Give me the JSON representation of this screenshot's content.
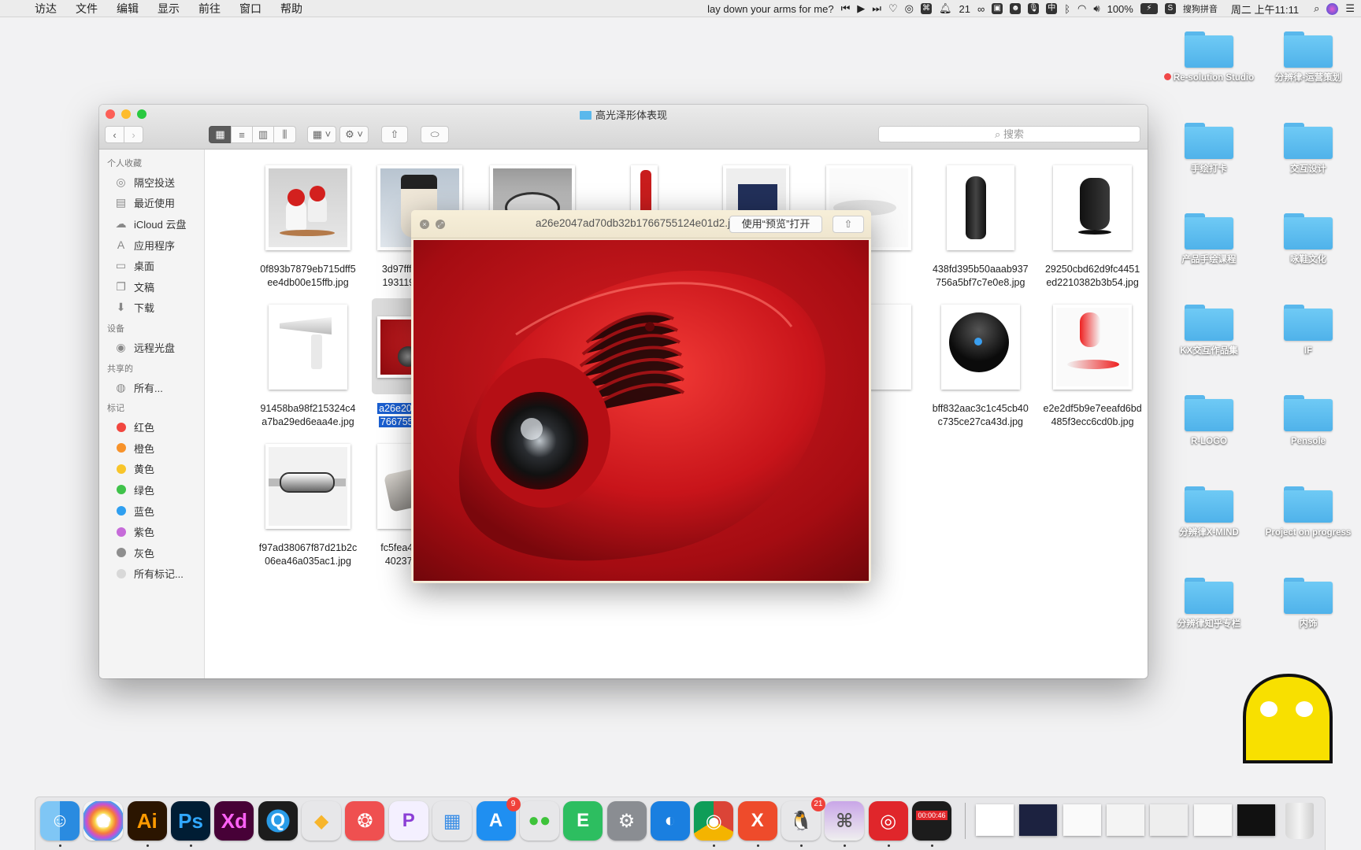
{
  "menubar": {
    "apple_icon": "apple-icon",
    "items": [
      "访达",
      "文件",
      "编辑",
      "显示",
      "前往",
      "窗口",
      "帮助"
    ],
    "now_playing": "lay down your arms for me?",
    "notification_count": "21",
    "battery": "100%",
    "input_method": "搜狗拼音",
    "clock": "周二 上午11:11"
  },
  "desktop": {
    "folders": [
      {
        "name": "Re-solution Studio",
        "tag": "#f04848"
      },
      {
        "name": "分辨律-运营策划"
      },
      {
        "name": "手绘打卡"
      },
      {
        "name": "交互设计"
      },
      {
        "name": "产品手绘课程"
      },
      {
        "name": "咏鞋文化"
      },
      {
        "name": "KX交互作品集"
      },
      {
        "name": "IF"
      },
      {
        "name": "R-LOGO"
      },
      {
        "name": "Pensole"
      },
      {
        "name": "分辨律X-MIND"
      },
      {
        "name": "Project on progress"
      },
      {
        "name": "分辨律知乎专栏"
      },
      {
        "name": "内饰"
      }
    ]
  },
  "finder": {
    "title": "高光泽形体表现",
    "search_placeholder": "搜索",
    "view_mode": "icon",
    "sidebar": [
      {
        "heading": "个人收藏",
        "items": [
          {
            "label": "隔空投送",
            "icon": "airdrop-icon",
            "glyph": "◎"
          },
          {
            "label": "最近使用",
            "icon": "recents-icon",
            "glyph": "▤"
          },
          {
            "label": "iCloud 云盘",
            "icon": "cloud-icon",
            "glyph": "☁"
          },
          {
            "label": "应用程序",
            "icon": "applications-icon",
            "glyph": "A"
          },
          {
            "label": "桌面",
            "icon": "desktop-icon",
            "glyph": "▭"
          },
          {
            "label": "文稿",
            "icon": "documents-icon",
            "glyph": "❐"
          },
          {
            "label": "下载",
            "icon": "downloads-icon",
            "glyph": "⬇"
          }
        ]
      },
      {
        "heading": "设备",
        "items": [
          {
            "label": "远程光盘",
            "icon": "disc-icon",
            "glyph": "◉"
          }
        ]
      },
      {
        "heading": "共享的",
        "items": [
          {
            "label": "所有...",
            "icon": "network-icon",
            "glyph": "◍"
          }
        ]
      },
      {
        "heading": "标记",
        "items": [
          {
            "label": "红色",
            "color": "#f1463f"
          },
          {
            "label": "橙色",
            "color": "#f7922a"
          },
          {
            "label": "黄色",
            "color": "#f8c52a"
          },
          {
            "label": "绿色",
            "color": "#3fc24a"
          },
          {
            "label": "蓝色",
            "color": "#2f9ff0"
          },
          {
            "label": "紫色",
            "color": "#c66bd9"
          },
          {
            "label": "灰色",
            "color": "#8e8e8e"
          },
          {
            "label": "所有标记...",
            "color": "#d8d8d8"
          }
        ]
      }
    ],
    "files": [
      {
        "name": [
          "0f893b7879eb715dff5",
          "ee4db00e15ffb.jpg"
        ],
        "kind": "bells",
        "row": 0,
        "col": 0
      },
      {
        "name": [
          "3d97fff70924b7f5",
          "1931199322aa9.j"
        ],
        "kind": "shaver",
        "row": 0,
        "col": 1
      },
      {
        "name": [
          "",
          ""
        ],
        "kind": "mouse",
        "row": 0,
        "col": 2
      },
      {
        "name": [
          "",
          ""
        ],
        "kind": "bottle",
        "row": 0,
        "col": 3
      },
      {
        "name": [
          "",
          ""
        ],
        "kind": "person",
        "row": 0,
        "col": 4
      },
      {
        "name": [
          "",
          "e"
        ],
        "kind": "magicmouse",
        "row": 0,
        "col": 5
      },
      {
        "name": [
          "438fd395b50aaab937",
          "756a5bf7c7e0e8.jpg"
        ],
        "kind": "razor",
        "row": 0,
        "col": 6
      },
      {
        "name": [
          "29250cbd62d9fc4451",
          "ed2210382b3b54.jpg"
        ],
        "kind": "router",
        "row": 0,
        "col": 7
      },
      {
        "name": [
          "91458ba98f215324c4",
          "a7ba29ed6eaa4e.jpg"
        ],
        "kind": "dryer",
        "row": 1,
        "col": 0
      },
      {
        "name": [
          "a26e2047ad70db3",
          "766755124e01d2."
        ],
        "kind": "projector",
        "row": 1,
        "col": 1,
        "selected": true
      },
      {
        "name": [
          "",
          "f"
        ],
        "kind": "blank",
        "row": 1,
        "col": 5
      },
      {
        "name": [
          "bff832aac3c1c45cb40",
          "c735ce27ca43d.jpg"
        ],
        "kind": "speaker",
        "row": 1,
        "col": 6
      },
      {
        "name": [
          "e2e2df5b9e7eeafd6bd",
          "485f3ecc6cd0b.jpg"
        ],
        "kind": "redmouse",
        "row": 1,
        "col": 7
      },
      {
        "name": [
          "f97ad38067f87d21b2c",
          "06ea46a035ac1.jpg"
        ],
        "kind": "watch",
        "row": 2,
        "col": 0
      },
      {
        "name": [
          "fc5fea4702051f96",
          "402376fca820f.j"
        ],
        "kind": "camera",
        "row": 2,
        "col": 1
      }
    ]
  },
  "quicklook": {
    "filename": "a26e2047ad70db32b1766755124e01d2.jpg",
    "open_with_label": "使用“预览”打开",
    "share_icon": "share-icon"
  },
  "dock": {
    "apps": [
      {
        "name": "finder",
        "glyph": "☺",
        "bg": "linear-gradient(90deg,#7fc6f5 50%,#2a8be0 50%)",
        "running": true
      },
      {
        "name": "photos",
        "glyph": "✿",
        "bg": "radial-gradient(circle,#fff 20%,#f9d44b 30%,#f57b3b 45%,#c94fd3 60%,#3ea0ef 75%,#f4f4f4 76%)"
      },
      {
        "name": "illustrator",
        "glyph": "Ai",
        "bg": "#2b1500",
        "color": "#ff9a00",
        "running": true
      },
      {
        "name": "photoshop",
        "glyph": "Ps",
        "bg": "#001d34",
        "color": "#31a8ff",
        "running": true
      },
      {
        "name": "xd",
        "glyph": "Xd",
        "bg": "#470137",
        "color": "#ff61f6"
      },
      {
        "name": "quicktime",
        "glyph": "Q",
        "bg": "radial-gradient(circle,#2a9ce8 40%,#1c1c1c 42%)"
      },
      {
        "name": "sketch",
        "glyph": "◆",
        "bg": "transparent",
        "color": "#f7b52c"
      },
      {
        "name": "dribbble",
        "glyph": "❂",
        "bg": "#ef5050"
      },
      {
        "name": "picgo",
        "glyph": "P",
        "bg": "#f4f0ff",
        "color": "#8b3fd6"
      },
      {
        "name": "keynote",
        "glyph": "▦",
        "bg": "transparent",
        "color": "#3a8ee6"
      },
      {
        "name": "app-store",
        "glyph": "A",
        "bg": "#1f8ff1",
        "badge": "9"
      },
      {
        "name": "wechat",
        "glyph": "●●",
        "bg": "transparent",
        "color": "#3ec33a"
      },
      {
        "name": "evernote",
        "glyph": "E",
        "bg": "#2dbe60"
      },
      {
        "name": "system-preferences",
        "glyph": "⚙",
        "bg": "#8a8d92"
      },
      {
        "name": "browser",
        "glyph": "◐",
        "bg": "#1a7fe0"
      },
      {
        "name": "chrome",
        "glyph": "◉",
        "bg": "conic-gradient(#db4437 0 33%,#f4b400 0 66%,#0f9d58 0)",
        "running": true
      },
      {
        "name": "xmind",
        "glyph": "X",
        "bg": "#ee4b2b",
        "running": true
      },
      {
        "name": "qq",
        "glyph": "🐧",
        "bg": "transparent",
        "color": "#111",
        "badge": "21",
        "running": true
      },
      {
        "name": "cheatsheet",
        "glyph": "⌘",
        "bg": "linear-gradient(#c9a6e8,#efefef)",
        "color": "#555",
        "running": true
      },
      {
        "name": "netease-music",
        "glyph": "◎",
        "bg": "#e0262b",
        "running": true
      },
      {
        "name": "screen-recorder",
        "glyph": "●",
        "bg": "#1c1c1c",
        "color": "#e0262b",
        "timer": "00:00:46",
        "running": true
      }
    ],
    "minimized_windows": [
      "car-window",
      "dark-window",
      "netease-window",
      "grid-window",
      "chrome-window",
      "qq-window",
      "photoshop-window"
    ],
    "trash_icon": "trash-icon"
  }
}
